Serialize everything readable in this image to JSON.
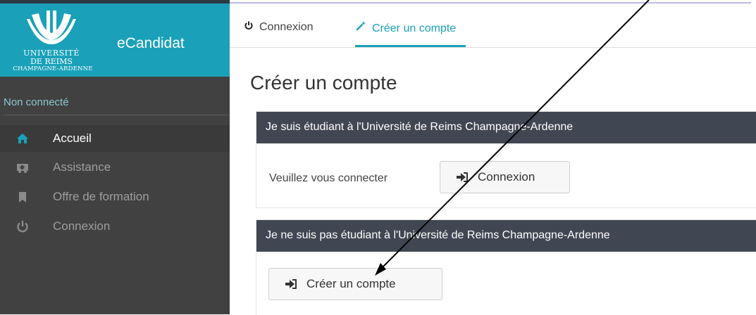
{
  "brand": {
    "university_line1": "UNIVERSITÉ",
    "university_line2": "DE REIMS",
    "university_line3": "CHAMPAGNE-ARDENNE",
    "app_name": "eCandidat",
    "color": "#1aa1b9"
  },
  "sidebar": {
    "status": "Non connecté",
    "items": [
      {
        "label": "Accueil",
        "icon": "home-icon",
        "active": true
      },
      {
        "label": "Assistance",
        "icon": "ambulance-icon",
        "active": false
      },
      {
        "label": "Offre de formation",
        "icon": "bookmark-icon",
        "active": false
      },
      {
        "label": "Connexion",
        "icon": "power-icon",
        "active": false
      }
    ]
  },
  "tabs": [
    {
      "label": "Connexion",
      "icon": "power-icon",
      "active": false
    },
    {
      "label": "Créer un compte",
      "icon": "magic-wand-icon",
      "active": true
    }
  ],
  "main": {
    "title": "Créer un compte",
    "panel1": {
      "header": "Je suis étudiant à l'Université de Reims Champagne-Ardenne",
      "text": "Veuillez vous connecter",
      "button": "Connexion",
      "button_icon": "sign-in-icon"
    },
    "panel2": {
      "header": "Je ne suis pas étudiant à l'Université de Reims Champagne-Ardenne",
      "button": "Créer un compte",
      "button_icon": "sign-in-icon"
    }
  }
}
